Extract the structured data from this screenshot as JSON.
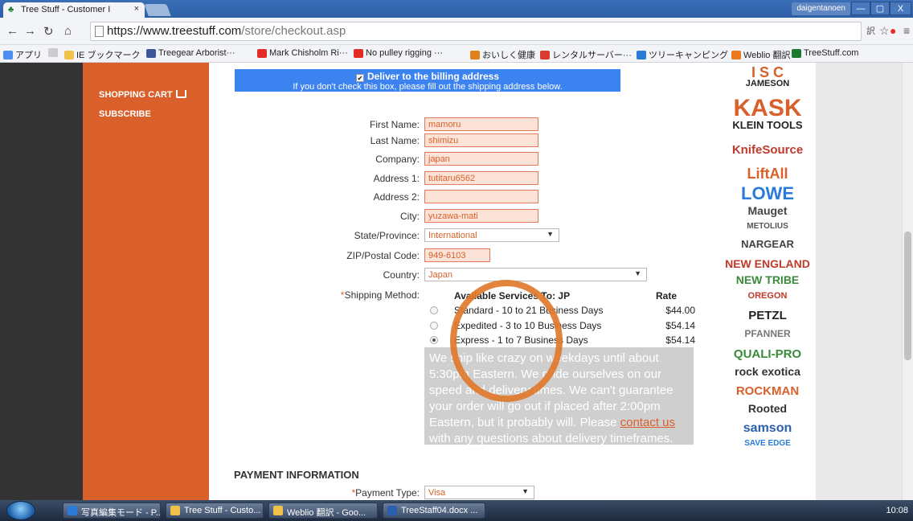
{
  "browser": {
    "tab_title": "Tree Stuff - Customer I",
    "tab_close": "×",
    "user": "daigentanoen",
    "url_host": "https://www.treestuff.com",
    "url_path": "/store/checkout.asp",
    "min": "—",
    "max": "▢",
    "close": "X"
  },
  "bookmarks": [
    {
      "label": "アプリ",
      "color": "#4b8df0"
    },
    {
      "label": "",
      "color": "#cccccc"
    },
    {
      "label": "IE ブックマーク",
      "color": "#f1c24a"
    },
    {
      "label": "Treegear Arborist···",
      "color": "#3b5998"
    },
    {
      "label": "Mark Chisholm Ri···",
      "color": "#e52d27"
    },
    {
      "label": "No pulley rigging ···",
      "color": "#e52d27"
    },
    {
      "label": "おいしく健康",
      "color": "#e0801c"
    },
    {
      "label": "レンタルサーバー···",
      "color": "#d93b2c"
    },
    {
      "label": "ツリーキャンピング",
      "color": "#2a7bd8"
    },
    {
      "label": "Weblio 翻訳",
      "color": "#e97a1e"
    },
    {
      "label": "TreeStuff.com",
      "color": "#1a7a2e"
    }
  ],
  "sidebar": {
    "cart": "SHOPPING CART",
    "subscribe": "SUBSCRIBE"
  },
  "billing": {
    "check": "✔",
    "line1": "Deliver to the billing address",
    "line2": "If you don't check this box, please fill out the shipping address below."
  },
  "form": {
    "first_name": {
      "label": "First Name:",
      "value": "mamoru"
    },
    "last_name": {
      "label": "Last Name:",
      "value": "shimizu"
    },
    "company": {
      "label": "Company:",
      "value": "japan"
    },
    "address1": {
      "label": "Address 1:",
      "value": "tutitaru6562"
    },
    "address2": {
      "label": "Address 2:",
      "value": ""
    },
    "city": {
      "label": "City:",
      "value": "yuzawa-mati"
    },
    "state": {
      "label": "State/Province:",
      "value": "International"
    },
    "zip": {
      "label": "ZIP/Postal Code:",
      "value": "949-6103"
    },
    "country": {
      "label": "Country:",
      "value": "Japan"
    }
  },
  "shipping": {
    "req": "*",
    "label": "Shipping Method:",
    "header": "Available Services To: JP",
    "rate_header": "Rate",
    "options": [
      {
        "name": "Standard - 10 to 21 Business Days",
        "rate": "$44.00",
        "selected": false
      },
      {
        "name": "Expedited - 3 to 10 Business Days",
        "rate": "$54.14",
        "selected": false
      },
      {
        "name": "Express - 1 to 7 Business Days",
        "rate": "$54.14",
        "selected": true
      }
    ],
    "notice_before": "We ship like crazy on weekdays until about 5:30pm Eastern. We pride ourselves on our speed and delivery times. We can't guarantee your order will go out if placed after 2:00pm Eastern, but it probably will. Please ",
    "notice_link": "contact us",
    "notice_after": " with any questions about delivery timeframes."
  },
  "payment": {
    "title": "PAYMENT INFORMATION",
    "req": "*",
    "type_label": "Payment Type:",
    "type_value": "Visa"
  },
  "brands": [
    {
      "name": "I S C",
      "color": "#d9602a",
      "size": 18
    },
    {
      "name": "JAMESON",
      "color": "#222222",
      "size": 11
    },
    {
      "name": "KASK",
      "color": "#d9602a",
      "size": 30
    },
    {
      "name": "KLEIN TOOLS",
      "color": "#222222",
      "size": 13
    },
    {
      "name": "KnifeSource",
      "color": "#c0392b",
      "size": 15
    },
    {
      "name": "LiftAll",
      "color": "#d9602a",
      "size": 18
    },
    {
      "name": "LOWE",
      "color": "#2a7bd8",
      "size": 22
    },
    {
      "name": "Mauget",
      "color": "#444444",
      "size": 14
    },
    {
      "name": "METOLIUS",
      "color": "#555555",
      "size": 10
    },
    {
      "name": "NARGEAR",
      "color": "#444444",
      "size": 13
    },
    {
      "name": "NEW ENGLAND",
      "color": "#c0392b",
      "size": 14
    },
    {
      "name": "NEW TRIBE",
      "color": "#3a8a3a",
      "size": 14
    },
    {
      "name": "OREGON",
      "color": "#c0392b",
      "size": 11
    },
    {
      "name": "PETZL",
      "color": "#222222",
      "size": 15
    },
    {
      "name": "PFANNER",
      "color": "#777777",
      "size": 12
    },
    {
      "name": "QUALI-PRO",
      "color": "#3a8a3a",
      "size": 15
    },
    {
      "name": "rock exotica",
      "color": "#333333",
      "size": 14
    },
    {
      "name": "ROCKMAN",
      "color": "#d9602a",
      "size": 15
    },
    {
      "name": "Rooted",
      "color": "#333333",
      "size": 14
    },
    {
      "name": "samson",
      "color": "#2a5fb0",
      "size": 16
    },
    {
      "name": "SAVE EDGE",
      "color": "#2a7bd8",
      "size": 10
    }
  ],
  "taskbar": {
    "tasks": [
      {
        "label": "写真編集モード - P...",
        "color": "#2a7bd8"
      },
      {
        "label": "Tree Stuff - Custo...",
        "color": "#f1c24a"
      },
      {
        "label": "Weblio 翻訳 - Goo...",
        "color": "#f1c24a"
      },
      {
        "label": "TreeStaff04.docx ...",
        "color": "#2a5fb0"
      }
    ],
    "clock": "10:08"
  }
}
